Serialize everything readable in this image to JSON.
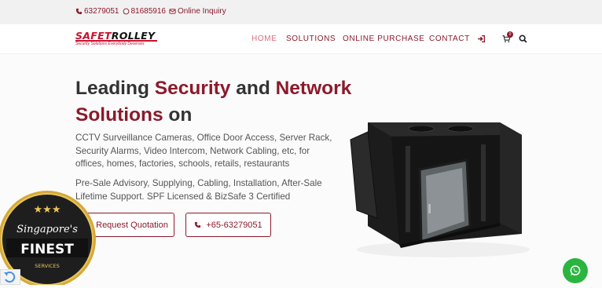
{
  "topbar": {
    "phone": "63279051",
    "whatsapp": "81685916",
    "inquiry": "Online Inquiry"
  },
  "logo": {
    "word_a": "SAFET",
    "word_b": "ROLLEY",
    "tagline": "Security Solutions Everybody Deserves"
  },
  "nav": {
    "items": [
      "HOME",
      "SOLUTIONS",
      "ONLINE PURCHASE",
      "CONTACT"
    ],
    "cart_count": "0",
    "icons": [
      "login-icon",
      "cart-icon",
      "search-icon"
    ]
  },
  "hero": {
    "title_1": "Leading ",
    "title_2": "Security",
    "title_3": " and ",
    "title_4": "Network",
    "title_5": "Solutions",
    "title_6": " on",
    "p1": "CCTV Surveillance Cameras, Office Door Access, Server Rack, Security Alarms, Video Intercom, Network Cabling, etc, for offices, homes, factories, schools, retails, restaurants",
    "p2": "Pre-Sale Advisory, Supplying, Cabling, Installation, After-Sale Lifetime Support. SPF Licensed & BizSafe 3 Certified",
    "btn_quote": "Request Quotation",
    "btn_phone": "+65-63279051"
  },
  "badge": {
    "line1": "Singapore's",
    "line2": "FINEST",
    "line3": "SERVICES"
  },
  "colors": {
    "brand": "#8b1a2b",
    "whatsapp": "#2ab540"
  }
}
